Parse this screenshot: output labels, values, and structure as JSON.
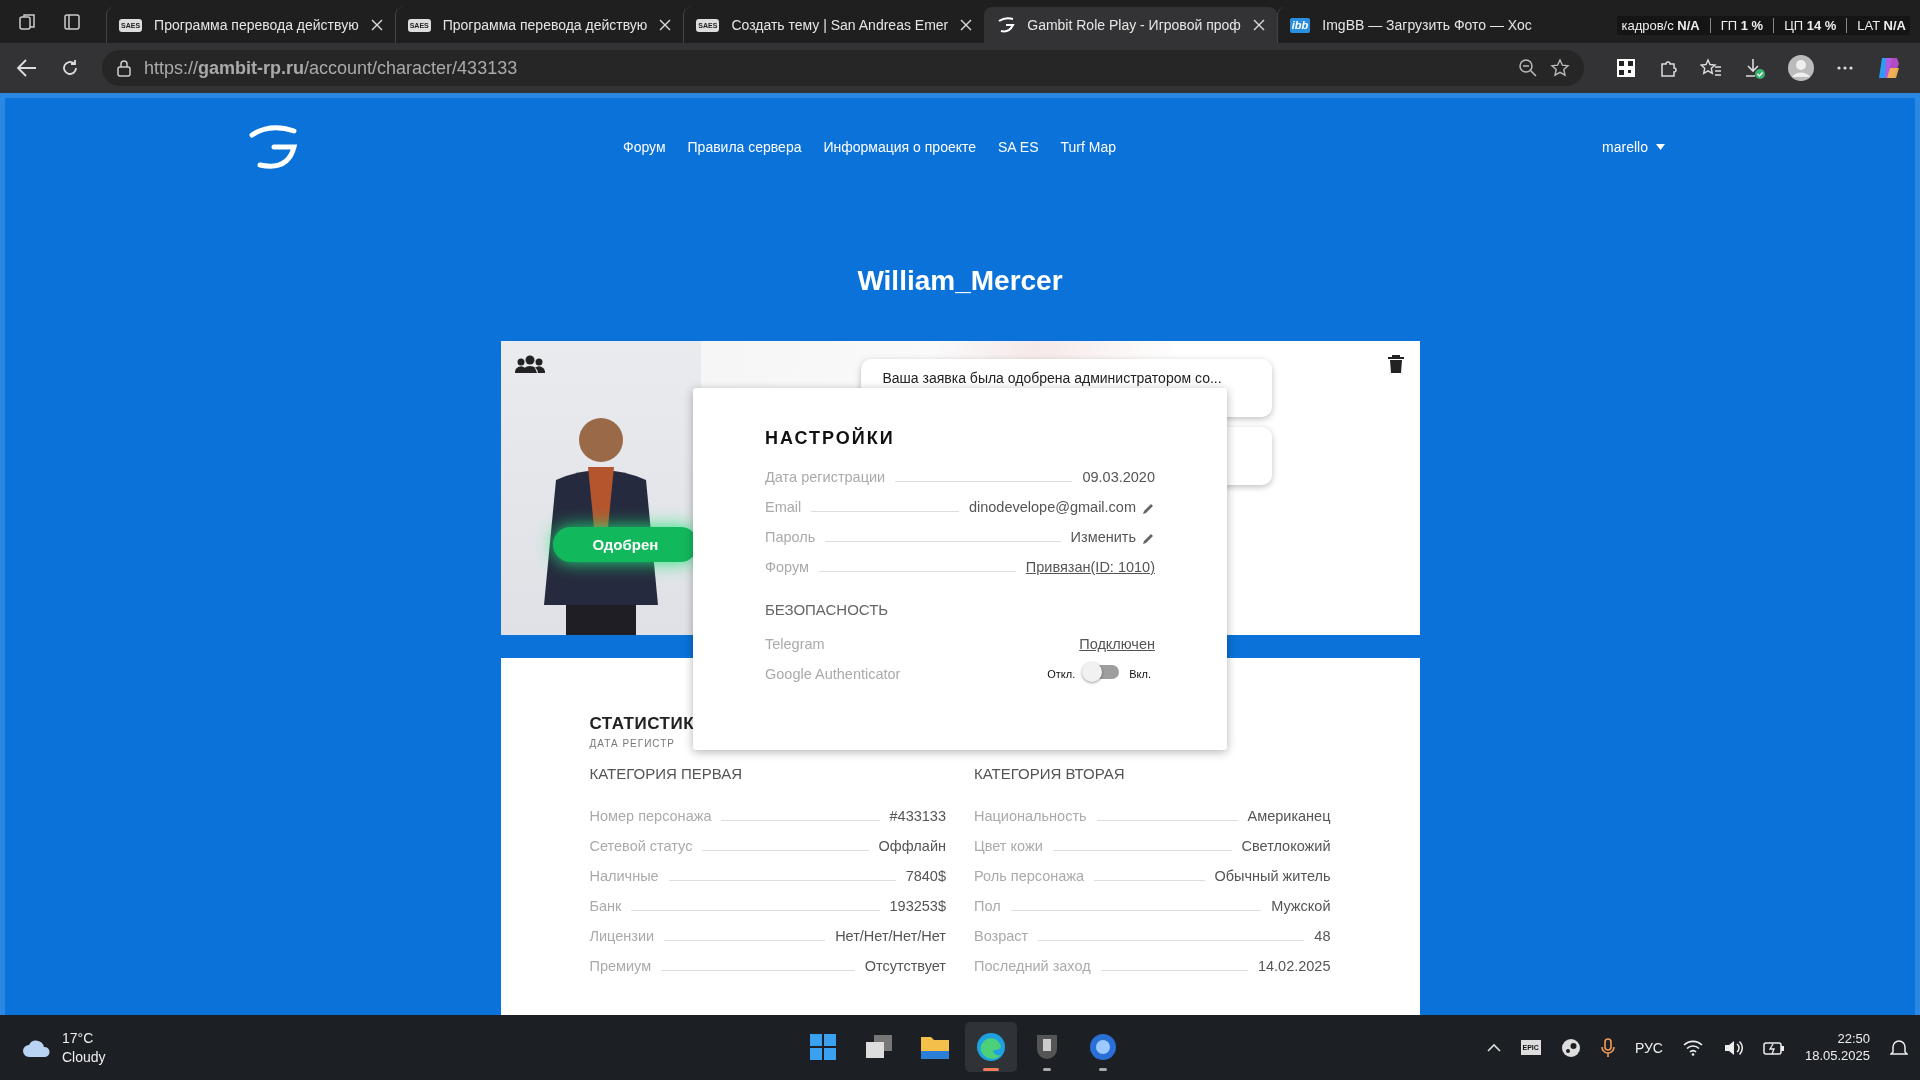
{
  "browser": {
    "tabs": [
      {
        "title": "Программа перевода действую",
        "icon_label": "SAES",
        "selected": false
      },
      {
        "title": "Программа перевода действую",
        "icon_label": "SAES",
        "selected": false
      },
      {
        "title": "Создать тему | San Andreas Emer",
        "icon_label": "SAES",
        "selected": false
      },
      {
        "title": "Gambit Role Play - Игровой проф",
        "selected": true
      },
      {
        "title": "ImgBB — Загрузить Фото — Хос",
        "icon_label": "ibb",
        "selected": false
      }
    ],
    "url": "https://**gambit-rp.ru**/account/character/433133",
    "perf_overlay": [
      {
        "label": "кадров/с",
        "value": "N/A"
      },
      {
        "label": "ГП",
        "value": "1 %"
      },
      {
        "label": "ЦП",
        "value": "14 %"
      },
      {
        "label": "LAT",
        "value": "N/A"
      }
    ]
  },
  "site": {
    "nav": [
      "Форум",
      "Правила сервера",
      "Информация о проекте",
      "SA ES",
      "Turf Map"
    ],
    "user": "marello"
  },
  "character": {
    "name": "William_Mercer",
    "status": "Одобрен",
    "notifications": [
      {
        "text": "Ваша заявка была одобрена администратором со..."
      }
    ]
  },
  "settings_modal": {
    "title": "НАСТРОЙКИ",
    "rows": [
      {
        "label": "Дата регистрации",
        "value": "09.03.2020",
        "kind": "text"
      },
      {
        "label": "Email",
        "value": "dinodevelope@gmail.com",
        "kind": "edit"
      },
      {
        "label": "Пароль",
        "value": "Изменить",
        "kind": "edit"
      },
      {
        "label": "Форум",
        "value": "Привязан(ID: 1010)",
        "kind": "link"
      }
    ],
    "security_title": "БЕЗОПАСНОСТЬ",
    "security_rows": [
      {
        "label": "Telegram",
        "value": "Подключен",
        "kind": "link"
      },
      {
        "label": "Google Authenticator",
        "kind": "toggle",
        "off_label": "Откл.",
        "on_label": "Вкл.",
        "on": false
      }
    ]
  },
  "stats": {
    "title": "СТАТИСТИК",
    "subtitle": "ДАТА РЕГИСТР",
    "categories": [
      {
        "title": "КАТЕГОРИЯ ПЕРВАЯ",
        "rows": [
          {
            "label": "Номер персонажа",
            "value": "#433133"
          },
          {
            "label": "Сетевой статус",
            "value": "Оффлайн"
          },
          {
            "label": "Наличные",
            "value": "7840$"
          },
          {
            "label": "Банк",
            "value": "193253$"
          },
          {
            "label": "Лицензии",
            "value": "Нет/Нет/Нет/Нет"
          },
          {
            "label": "Премиум",
            "value": "Отсутствует"
          }
        ]
      },
      {
        "title": "КАТЕГОРИЯ ВТОРАЯ",
        "rows": [
          {
            "label": "Национальность",
            "value": "Американец"
          },
          {
            "label": "Цвет кожи",
            "value": "Светлокожий"
          },
          {
            "label": "Роль персонажа",
            "value": "Обычный житель"
          },
          {
            "label": "Пол",
            "value": "Мужской"
          },
          {
            "label": "Возраст",
            "value": "48"
          },
          {
            "label": "Последний заход",
            "value": "14.02.2025"
          }
        ]
      }
    ]
  },
  "taskbar": {
    "weather": {
      "temp": "17°C",
      "condition": "Cloudy"
    },
    "apps": [
      {
        "kind": "start",
        "active": false,
        "running": false
      },
      {
        "kind": "taskview",
        "active": false,
        "running": false
      },
      {
        "kind": "explorer",
        "active": false,
        "running": false
      },
      {
        "kind": "edge",
        "active": true,
        "running": true
      },
      {
        "kind": "tank",
        "active": false,
        "running": true
      },
      {
        "kind": "orb",
        "active": false,
        "running": true
      }
    ],
    "epic_label": "EPIC",
    "language": "РУС",
    "time": "22:50",
    "date": "18.05.2025"
  }
}
